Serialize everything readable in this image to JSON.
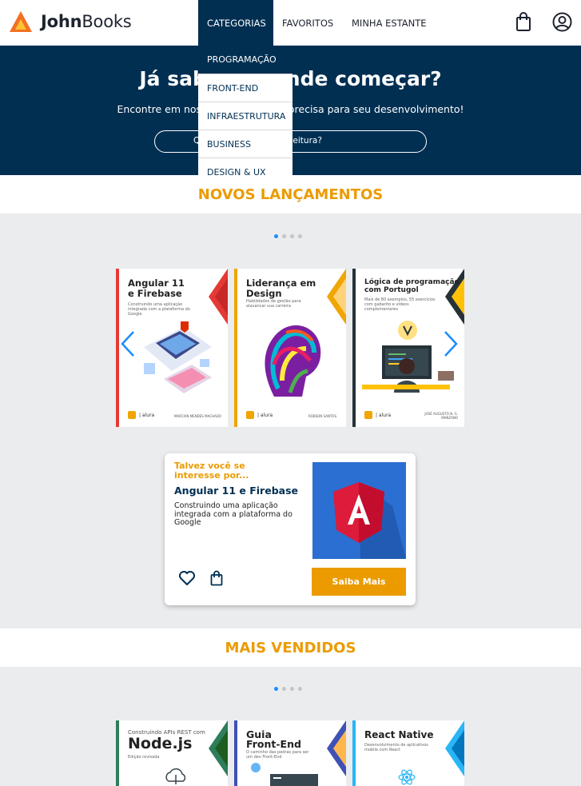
{
  "header": {
    "logo_bold": "John",
    "logo_rest": "Books",
    "nav": [
      "CATEGORIAS",
      "FAVORITOS",
      "MINHA ESTANTE"
    ]
  },
  "dropdown": {
    "items": [
      "PROGRAMAÇÃO",
      "FRONT-END",
      "INFRAESTRUTURA",
      "BUSINESS",
      "DESIGN & UX"
    ]
  },
  "hero": {
    "title": "Já sabe por onde começar?",
    "subtitle": "Encontre em nossa estante o que precisa para seu desenvolvimento!",
    "search_placeholder": "Qual será sua próxima leitura?"
  },
  "lancamentos": {
    "title": "NOVOS LANÇAMENTOS",
    "books": [
      {
        "title": "Angular 11\ne Firebase",
        "desc": "Construindo uma aplicação integrada com a plataforma do Google",
        "author": "MARCIAN MENDES MACHADO",
        "color": "#e53935"
      },
      {
        "title": "Liderança em\nDesign",
        "desc": "Habilidades de gestão para alavancar sua carreira",
        "author": "ROBSON SANTOS",
        "color": "#f0a500"
      },
      {
        "title": "Lógica de programação\ncom Portugol",
        "desc": "Mais de 80 exemplos, 55 exercícios com gabarito e vídeos complementares",
        "author": "JOSÉ AUGUSTO N. G. MANZANO",
        "color": "#263238"
      }
    ]
  },
  "card": {
    "kicker": "Talvez você se interesse por...",
    "title": "Angular 11 e Firebase",
    "desc": "Construindo uma aplicação integrada com a plataforma do Google",
    "button": "Saiba Mais"
  },
  "vendidos": {
    "title": "MAIS VENDIDOS",
    "books": [
      {
        "title": "Node.js",
        "pre": "Construindo APIs REST com",
        "desc": "Edição revisada",
        "color": "#2e7d5b"
      },
      {
        "title": "Guia\nFront-End",
        "desc": "O caminho das pedras para ser um dev Front-End",
        "color": "#3f51b5"
      },
      {
        "title": "React Native",
        "desc": "Desenvolvimento de aplicativos mobile com React",
        "color": "#29b6f6"
      }
    ]
  },
  "colors": {
    "navy": "#002f52",
    "accent": "#eb9b00"
  },
  "icons": [
    "logo-triangle-icon",
    "shopping-bag-icon",
    "user-icon",
    "chevron-left-icon",
    "chevron-right-icon",
    "heart-icon"
  ]
}
